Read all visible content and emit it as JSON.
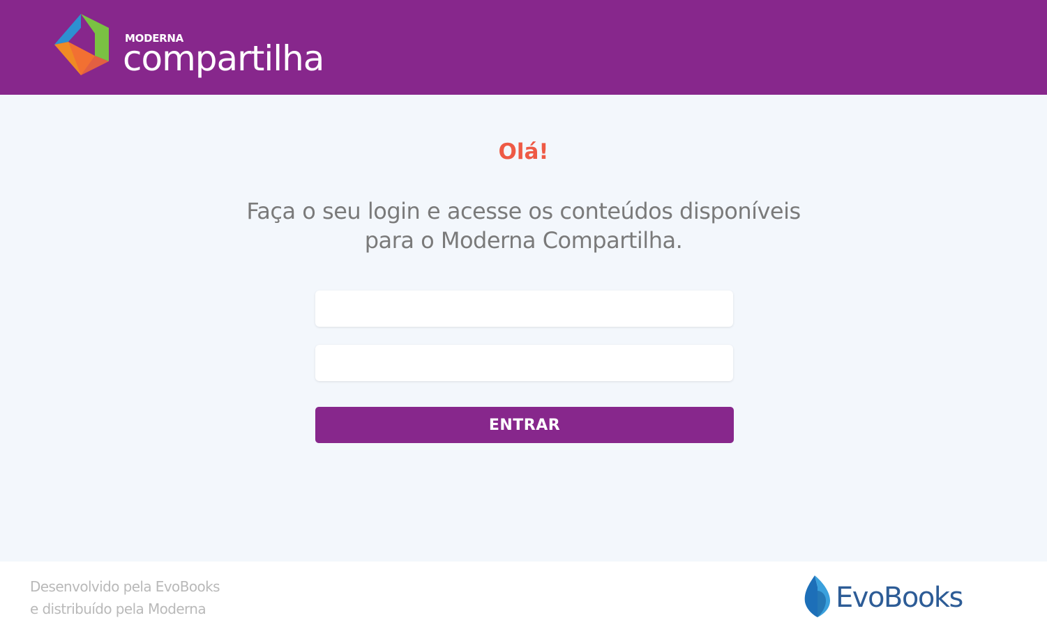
{
  "header": {
    "brand_small": "MODERNA",
    "brand_big": "compartilha",
    "logo_icon": "moderna-compartilha-logo-icon",
    "background_color": "#87278c"
  },
  "main": {
    "greeting": "Olá!",
    "intro_line1": "Faça o seu login e acesse os conteúdos disponíveis",
    "intro_line2": "para o Moderna Compartilha.",
    "username_field": {
      "value": "",
      "placeholder": ""
    },
    "password_field": {
      "value": "",
      "placeholder": ""
    },
    "enter_label": "ENTRAR",
    "greeting_color": "#ee5a45",
    "button_color": "#87278c"
  },
  "footer": {
    "credit_line1": "Desenvolvido pela EvoBooks",
    "credit_line2": "e distribuído pela Moderna",
    "partner_logo_text": "EvoBooks",
    "partner_logo_icon": "evobooks-logo-icon",
    "partner_color": "#2d5c96"
  }
}
